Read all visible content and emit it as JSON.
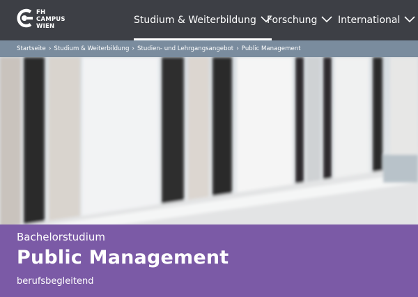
{
  "header": {
    "logo": {
      "text": [
        "FH",
        "CAMPUS",
        "WIEN"
      ],
      "icon": "fh-campus-wien-logo"
    },
    "nav": [
      {
        "label": "Studium & Weiterbildung",
        "active": true
      },
      {
        "label": "Forschung",
        "active": false
      },
      {
        "label": "International",
        "active": false
      }
    ]
  },
  "breadcrumb": [
    "Startseite",
    "Studium & Weiterbildung",
    "Studien- und Lehrgangsangebot",
    "Public Management"
  ],
  "banner": {
    "kicker": "Bachelorstudium",
    "title": "Public Management",
    "subtitle": "berufsbegleitend"
  },
  "colors": {
    "header_bg": "#3d3f45",
    "breadcrumb_bg": "#7a8c9e",
    "banner_bg": "#7b5aa6",
    "text": "#ffffff"
  }
}
